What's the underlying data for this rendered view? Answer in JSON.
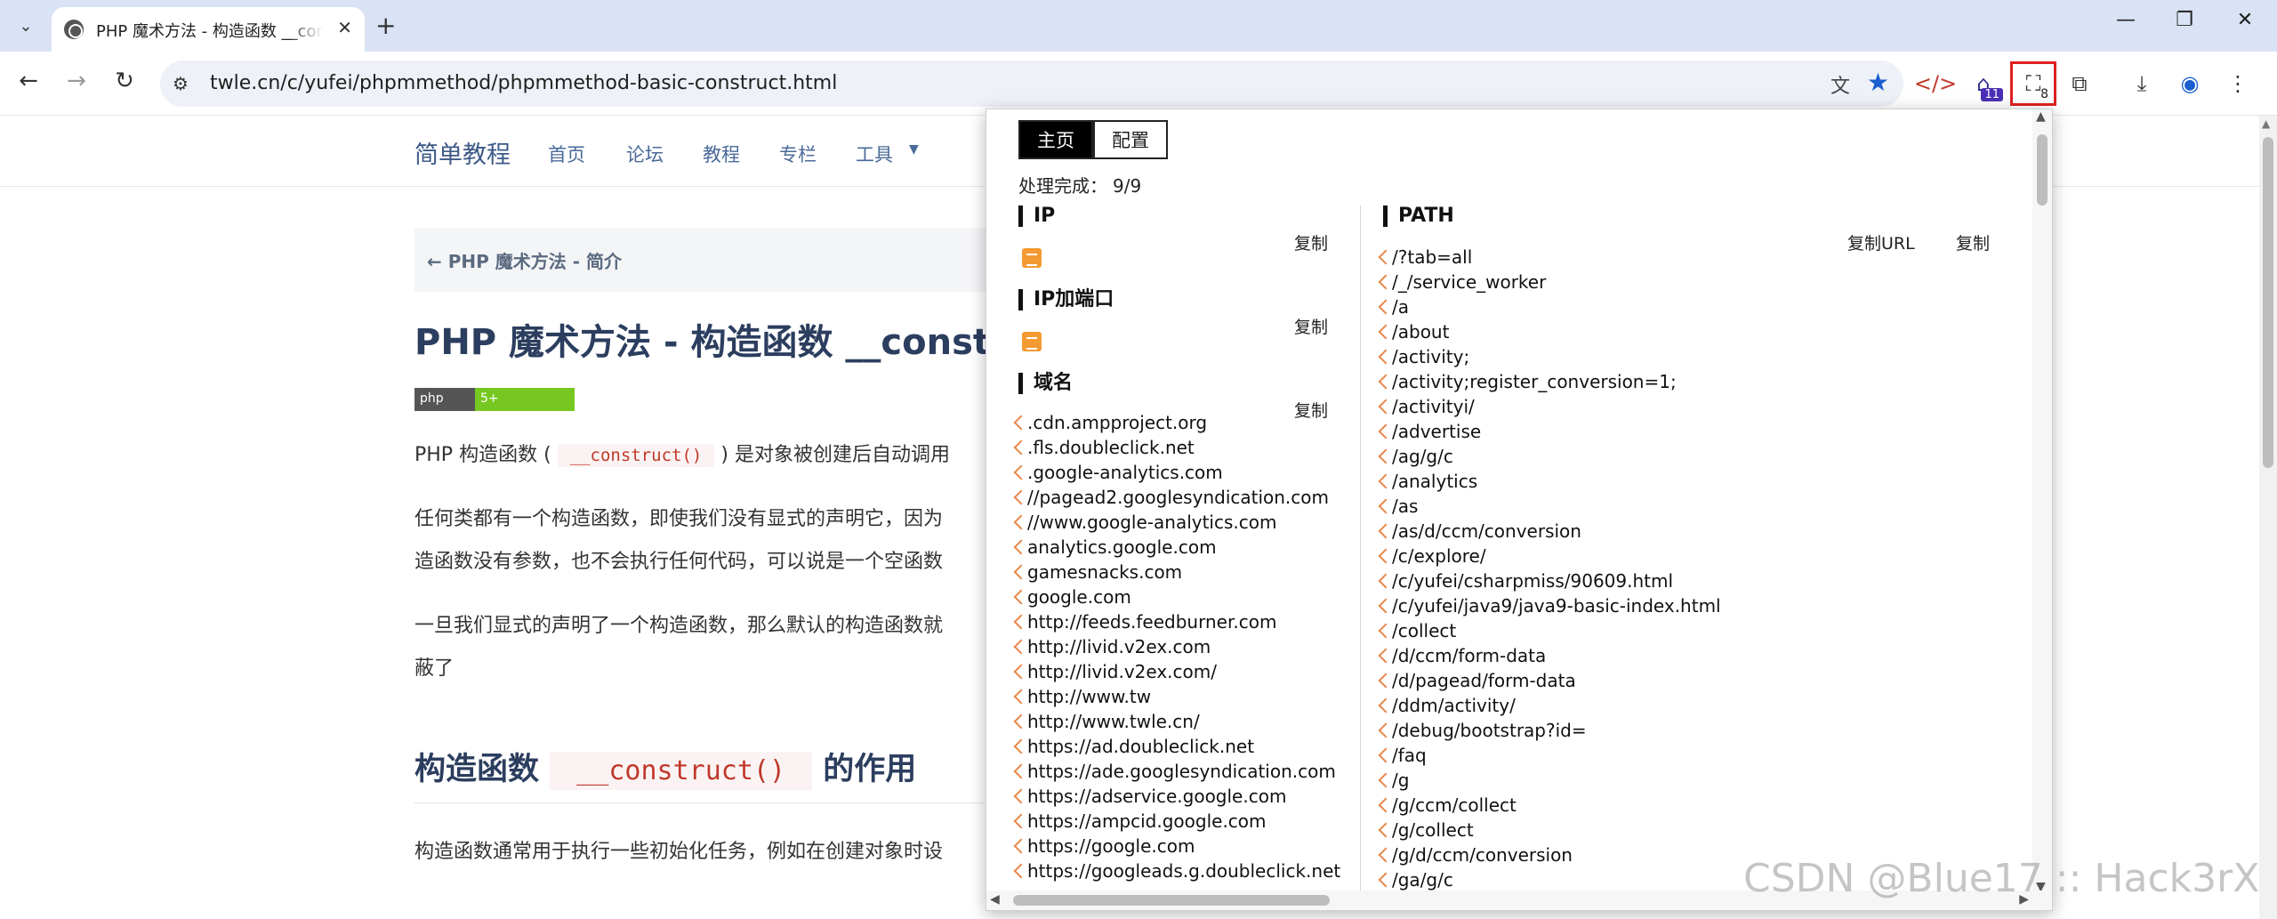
{
  "browser": {
    "tab_title": "PHP 魔术方法 - 构造函数  __construct",
    "tab_close": "✕",
    "new_tab": "+",
    "url": "twle.cn/c/yufei/phpmmethod/phpmmethod-basic-construct.html",
    "ext_badge_1": "11",
    "ext_badge_2": "8",
    "window": {
      "minimize": "—",
      "restore": "❐",
      "close": "✕"
    }
  },
  "site": {
    "brand": "简单教程",
    "nav": [
      "首页",
      "论坛",
      "教程",
      "专栏",
      "工具"
    ],
    "prev_link": "← PHP 魔术方法 - 简介",
    "title": "PHP 魔术方法 - 构造函数 __construct",
    "badge_lang": "php",
    "badge_version": "5+",
    "p1_a": "PHP 构造函数 (",
    "p1_code": "__construct()",
    "p1_b": ") 是对象被创建后自动调用",
    "p2_line1": "任何类都有一个构造函数，即使我们没有显式的声明它，因为",
    "p2_line2": "造函数没有参数，也不会执行任何代码，可以说是一个空函数",
    "p3_line1": "一旦我们显式的声明了一个构造函数，那么默认的构造函数就",
    "p3_line2": "蔽了",
    "h2_a": "构造函数",
    "h2_code": "__construct()",
    "h2_b": "的作用",
    "p4": "构造函数通常用于执行一些初始化任务，例如在创建对象时设"
  },
  "popup": {
    "tabs": [
      "主页",
      "配置"
    ],
    "status_label": "处理完成：",
    "status_value": "9/9",
    "sections": {
      "ip": "IP",
      "ip_port": "IP加端口",
      "domain": "域名",
      "path": "PATH"
    },
    "copy": "复制",
    "copy_url": "复制URL",
    "domains": [
      ".cdn.ampproject.org",
      ".fls.doubleclick.net",
      ".google-analytics.com",
      "//pagead2.googlesyndication.com",
      "//www.google-analytics.com",
      "analytics.google.com",
      "gamesnacks.com",
      "google.com",
      "http://feeds.feedburner.com",
      "http://livid.v2ex.com",
      "http://livid.v2ex.com/",
      "http://www.tw",
      "http://www.twle.cn/",
      "https://ad.doubleclick.net",
      "https://ade.googlesyndication.com",
      "https://adservice.google.com",
      "https://ampcid.google.com",
      "https://google.com",
      "https://googleads.g.doubleclick.net"
    ],
    "paths": [
      "/?tab=all",
      "/_/service_worker",
      "/a",
      "/about",
      "/activity;",
      "/activity;register_conversion=1;",
      "/activityi/",
      "/advertise",
      "/ag/g/c",
      "/analytics",
      "/as",
      "/as/d/ccm/conversion",
      "/c/explore/",
      "/c/yufei/csharpmiss/90609.html",
      "/c/yufei/java9/java9-basic-index.html",
      "/collect",
      "/d/ccm/form-data",
      "/d/pagead/form-data",
      "/ddm/activity/",
      "/debug/bootstrap?id=",
      "/faq",
      "/g",
      "/g/ccm/collect",
      "/g/collect",
      "/g/d/ccm/conversion",
      "/ga/g/c"
    ]
  },
  "watermark": "CSDN @Blue17 :: Hack3rX"
}
